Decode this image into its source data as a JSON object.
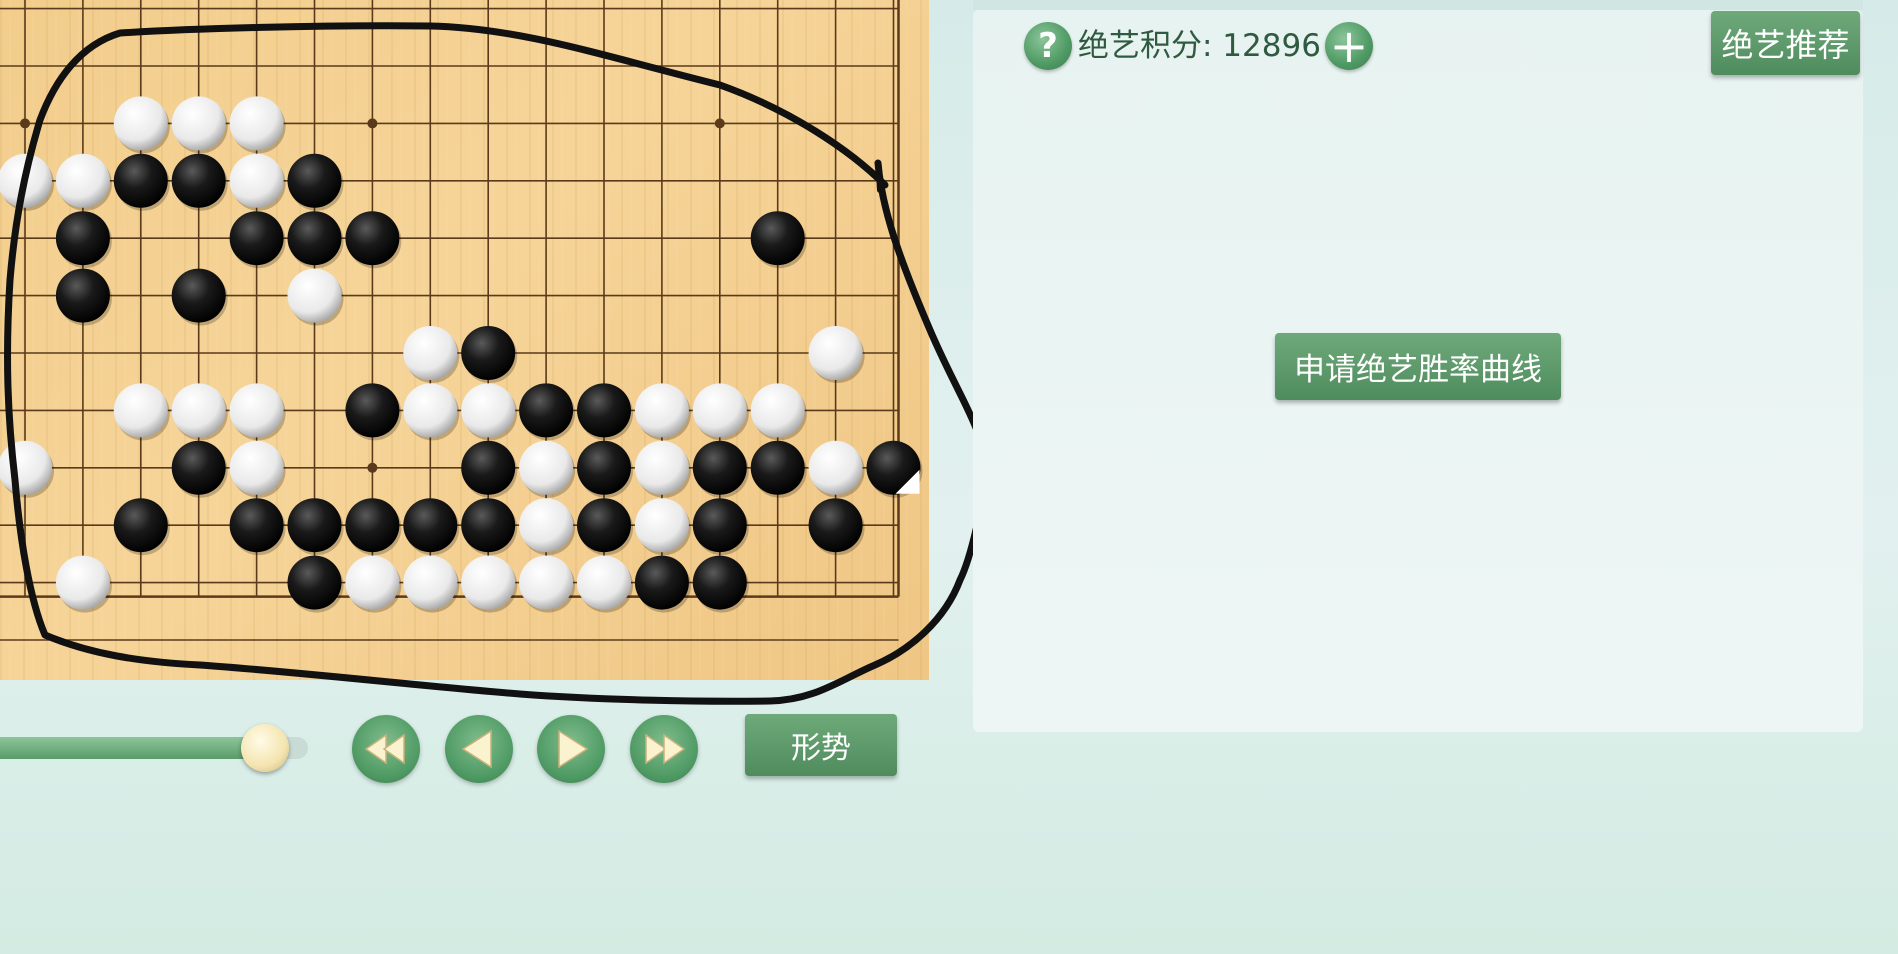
{
  "board": {
    "stones": [
      {
        "c": "w",
        "col": 2,
        "row": 2
      },
      {
        "c": "w",
        "col": 3,
        "row": 2
      },
      {
        "c": "w",
        "col": 4,
        "row": 2
      },
      {
        "c": "w",
        "col": 0,
        "row": 3
      },
      {
        "c": "w",
        "col": 1,
        "row": 3
      },
      {
        "c": "b",
        "col": 2,
        "row": 3
      },
      {
        "c": "b",
        "col": 3,
        "row": 3
      },
      {
        "c": "w",
        "col": 4,
        "row": 3
      },
      {
        "c": "b",
        "col": 5,
        "row": 3
      },
      {
        "c": "b",
        "col": 1,
        "row": 4
      },
      {
        "c": "b",
        "col": 4,
        "row": 4
      },
      {
        "c": "b",
        "col": 5,
        "row": 4
      },
      {
        "c": "b",
        "col": 6,
        "row": 4
      },
      {
        "c": "b",
        "col": 13,
        "row": 4
      },
      {
        "c": "b",
        "col": 1,
        "row": 5
      },
      {
        "c": "b",
        "col": 3,
        "row": 5
      },
      {
        "c": "w",
        "col": 5,
        "row": 5
      },
      {
        "c": "w",
        "col": 7,
        "row": 6
      },
      {
        "c": "b",
        "col": 8,
        "row": 6
      },
      {
        "c": "w",
        "col": 14,
        "row": 6
      },
      {
        "c": "w",
        "col": 2,
        "row": 7
      },
      {
        "c": "w",
        "col": 3,
        "row": 7
      },
      {
        "c": "w",
        "col": 4,
        "row": 7
      },
      {
        "c": "b",
        "col": 6,
        "row": 7
      },
      {
        "c": "w",
        "col": 7,
        "row": 7
      },
      {
        "c": "w",
        "col": 8,
        "row": 7
      },
      {
        "c": "b",
        "col": 9,
        "row": 7
      },
      {
        "c": "b",
        "col": 10,
        "row": 7
      },
      {
        "c": "w",
        "col": 11,
        "row": 7
      },
      {
        "c": "w",
        "col": 12,
        "row": 7
      },
      {
        "c": "w",
        "col": 13,
        "row": 7
      },
      {
        "c": "w",
        "col": 0,
        "row": 8
      },
      {
        "c": "b",
        "col": 3,
        "row": 8
      },
      {
        "c": "w",
        "col": 4,
        "row": 8
      },
      {
        "c": "b",
        "col": 8,
        "row": 8
      },
      {
        "c": "w",
        "col": 9,
        "row": 8
      },
      {
        "c": "b",
        "col": 10,
        "row": 8
      },
      {
        "c": "w",
        "col": 11,
        "row": 8
      },
      {
        "c": "b",
        "col": 12,
        "row": 8
      },
      {
        "c": "b",
        "col": 13,
        "row": 8
      },
      {
        "c": "w",
        "col": 14,
        "row": 8
      },
      {
        "c": "b",
        "col": 15,
        "row": 8,
        "last": true
      },
      {
        "c": "b",
        "col": 2,
        "row": 9
      },
      {
        "c": "b",
        "col": 4,
        "row": 9
      },
      {
        "c": "b",
        "col": 5,
        "row": 9
      },
      {
        "c": "b",
        "col": 6,
        "row": 9
      },
      {
        "c": "b",
        "col": 7,
        "row": 9
      },
      {
        "c": "b",
        "col": 8,
        "row": 9
      },
      {
        "c": "w",
        "col": 9,
        "row": 9
      },
      {
        "c": "b",
        "col": 10,
        "row": 9
      },
      {
        "c": "w",
        "col": 11,
        "row": 9
      },
      {
        "c": "b",
        "col": 12,
        "row": 9
      },
      {
        "c": "b",
        "col": 14,
        "row": 9
      },
      {
        "c": "w",
        "col": 1,
        "row": 10
      },
      {
        "c": "b",
        "col": 5,
        "row": 10
      },
      {
        "c": "w",
        "col": 6,
        "row": 10
      },
      {
        "c": "w",
        "col": 7,
        "row": 10
      },
      {
        "c": "w",
        "col": 8,
        "row": 10
      },
      {
        "c": "w",
        "col": 9,
        "row": 10
      },
      {
        "c": "w",
        "col": 10,
        "row": 10
      },
      {
        "c": "b",
        "col": 11,
        "row": 10
      },
      {
        "c": "b",
        "col": 12,
        "row": 10
      }
    ],
    "star_points": [
      {
        "col": 0,
        "row": 2
      },
      {
        "col": 6,
        "row": 2
      },
      {
        "col": 12,
        "row": 2
      },
      {
        "col": 0,
        "row": 8
      },
      {
        "col": 6,
        "row": 8
      },
      {
        "col": 12,
        "row": 8
      }
    ]
  },
  "header": {
    "help_icon": "question-mark-icon",
    "help_glyph": "?",
    "score_label": "绝艺积分: 12896",
    "add_icon": "plus-icon",
    "add_glyph": "+",
    "recommend_label": "绝艺推荐"
  },
  "panel": {
    "curve_button_label": "申请绝艺胜率曲线"
  },
  "controls": {
    "progress": 0.86,
    "buttons": [
      {
        "name": "first-move-button",
        "icon": "double-left-arrow-icon"
      },
      {
        "name": "previous-move-button",
        "icon": "left-arrow-icon"
      },
      {
        "name": "next-move-button",
        "icon": "right-arrow-icon"
      },
      {
        "name": "last-move-button",
        "icon": "double-right-arrow-icon"
      }
    ],
    "situation_label": "形势"
  },
  "colors": {
    "accent_green": "#4f9a64",
    "board_wood": "#f4d092",
    "grid_line": "#5a3a1a"
  }
}
